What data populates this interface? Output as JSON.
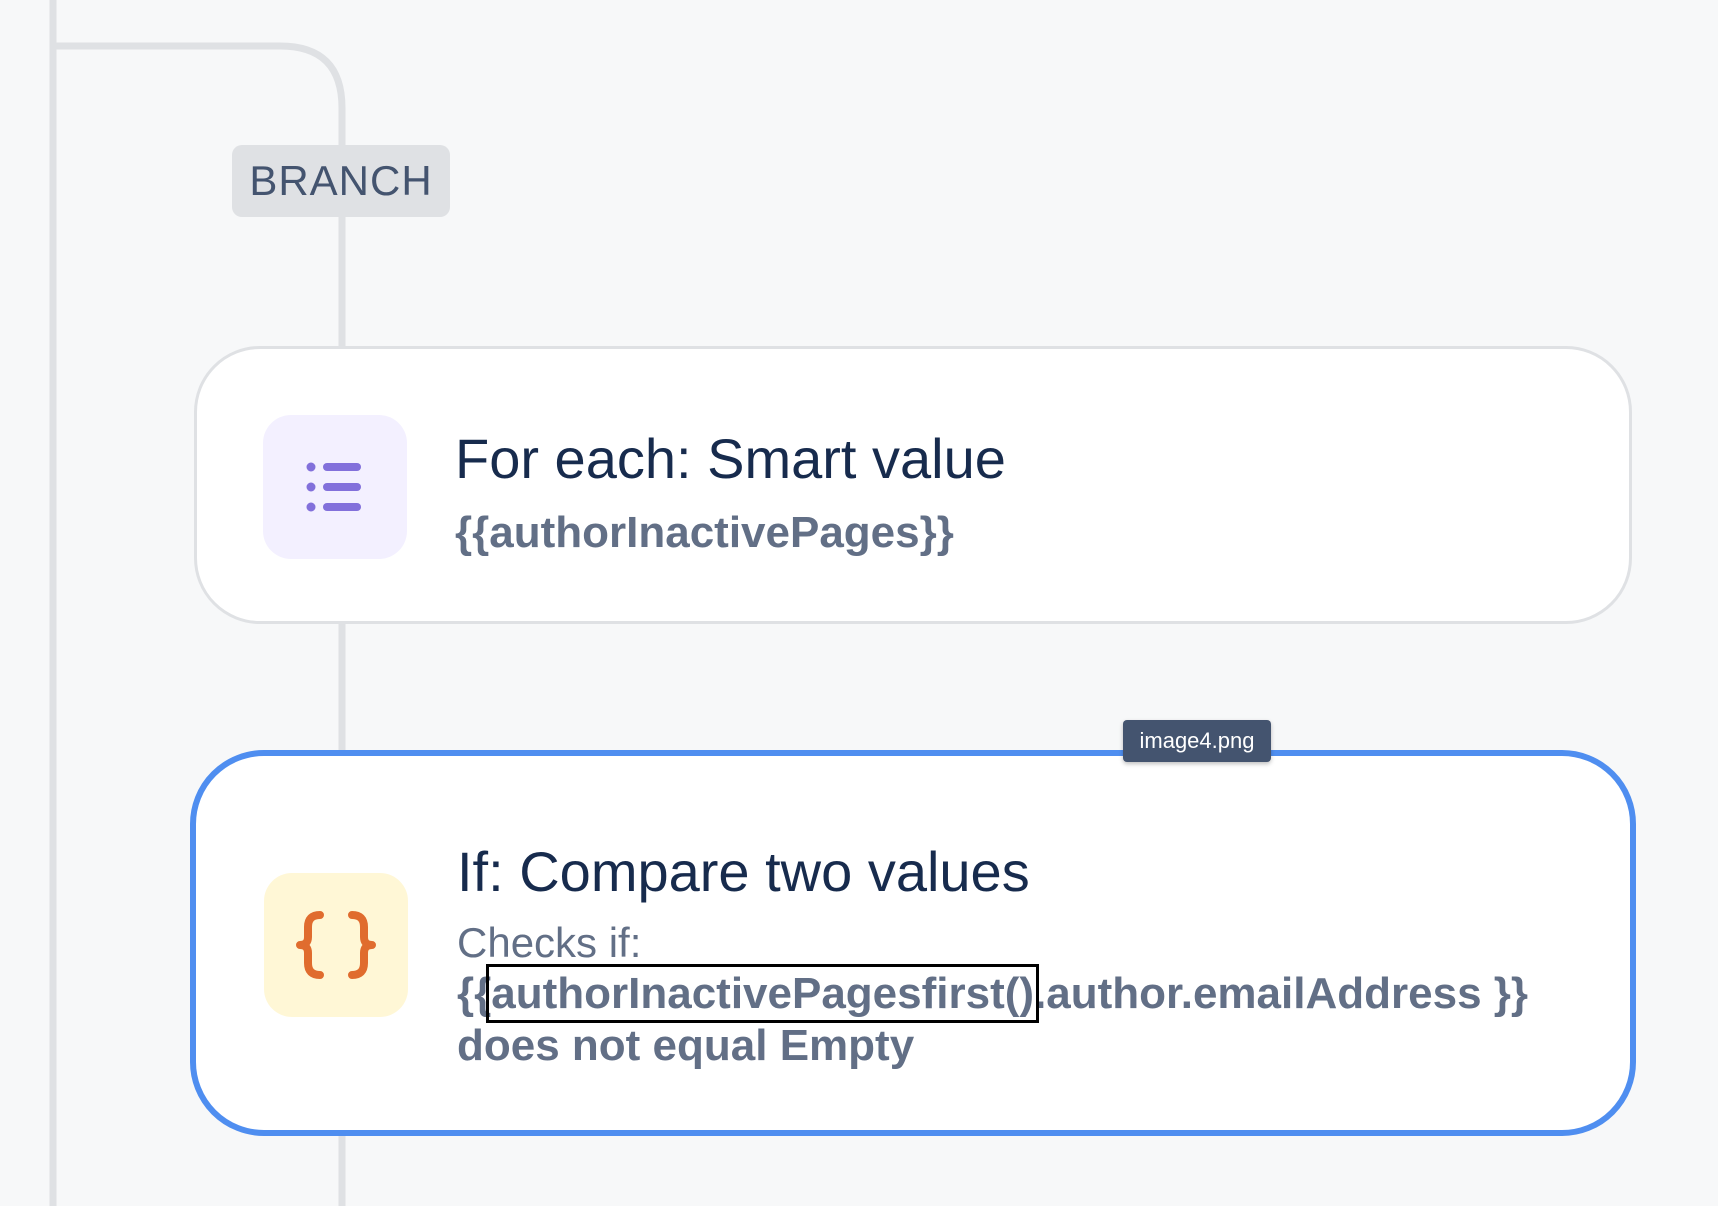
{
  "colors": {
    "canvas_bg": "#f7f8f9",
    "connector": "#dfe1e4",
    "badge_bg": "#dfe1e4",
    "badge_text": "#44546f",
    "selected_border": "#4f8ef0",
    "title_text": "#172b4d",
    "subtext": "#626f86",
    "foreach_icon": "#8270db",
    "foreach_tile": "#f3f0ff",
    "if_icon": "#e06c2e",
    "if_tile": "#fff7d6",
    "tooltip_bg": "#44546f"
  },
  "branch": {
    "label": "BRANCH"
  },
  "foreach_card": {
    "icon": "list-icon",
    "title": "For each: Smart value",
    "value": "{{authorInactivePages}}"
  },
  "if_card": {
    "icon": "curly-braces-icon",
    "title": "If: Compare two values",
    "checks_label": "Checks if:",
    "expr_open": "{{",
    "expr_highlight": "authorInactivePagesfirst()",
    "expr_rest": ".author.emailAddress }} does not equal Empty",
    "selected": true
  },
  "tooltip": {
    "text": "image4.png"
  }
}
